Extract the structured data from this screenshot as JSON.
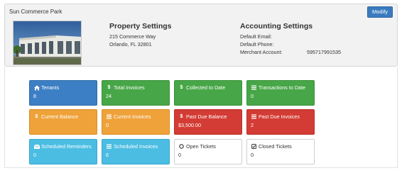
{
  "property": {
    "name": "Sun Commerce Park",
    "modify_label": "Modify"
  },
  "property_settings": {
    "title": "Property Settings",
    "address_line1": "215 Commerce Way",
    "address_line2": "Orlando, FL 32801"
  },
  "accounting_settings": {
    "title": "Accounting Settings",
    "default_email_label": "Default Email:",
    "default_email_value": "",
    "default_phone_label": "Default Phone:",
    "default_phone_value": "",
    "merchant_account_label": "Merchant Account:",
    "merchant_account_value": "595717991535"
  },
  "tiles": [
    {
      "label": "Tenants",
      "value": "8",
      "icon": "home-icon",
      "color": "#3c7fc4"
    },
    {
      "label": "Total Invoices",
      "value": "24",
      "icon": "dollar-icon",
      "color": "#47a647"
    },
    {
      "label": "Collected to Date",
      "value": "",
      "icon": "dollar-icon",
      "color": "#47a647"
    },
    {
      "label": "Transactions to Date",
      "value": "0",
      "icon": "list-icon",
      "color": "#47a647"
    },
    {
      "label": "Current Balance",
      "value": "",
      "icon": "dollar-icon",
      "color": "#efa23a"
    },
    {
      "label": "Current Invoices",
      "value": "0",
      "icon": "list-icon",
      "color": "#efa23a"
    },
    {
      "label": "Past Due Balance",
      "value": "$3,500.00",
      "icon": "dollar-icon",
      "color": "#d33c34"
    },
    {
      "label": "Past Due Invoices",
      "value": "2",
      "icon": "list-icon",
      "color": "#d33c34"
    },
    {
      "label": "Scheduled Reminders",
      "value": "0",
      "icon": "envelope-icon",
      "color": "#4bbde2"
    },
    {
      "label": "Scheduled Invoices",
      "value": "6",
      "icon": "list-icon",
      "color": "#4bbde2"
    },
    {
      "label": "Open Tickets",
      "value": "0",
      "icon": "circle-icon",
      "color": "#ffffff"
    },
    {
      "label": "Closed Tickets",
      "value": "0",
      "icon": "check-square-icon",
      "color": "#ffffff"
    }
  ]
}
